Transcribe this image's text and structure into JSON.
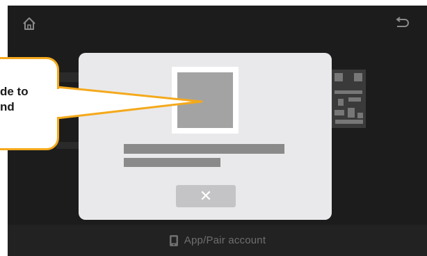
{
  "header": {
    "home_icon": "home-icon",
    "back_icon": "back-arrow-icon"
  },
  "footer": {
    "icon": "phone-app-icon",
    "label": "App/Pair account"
  },
  "dialog": {
    "close_label": "✕"
  },
  "callout": {
    "line1": "de to",
    "line2": "nd"
  },
  "colors": {
    "screen_bg": "#1c1c1c",
    "dialog_bg": "#e9e9eb",
    "callout_border": "#f4a91c",
    "placeholder_gray": "#a3a3a3"
  }
}
